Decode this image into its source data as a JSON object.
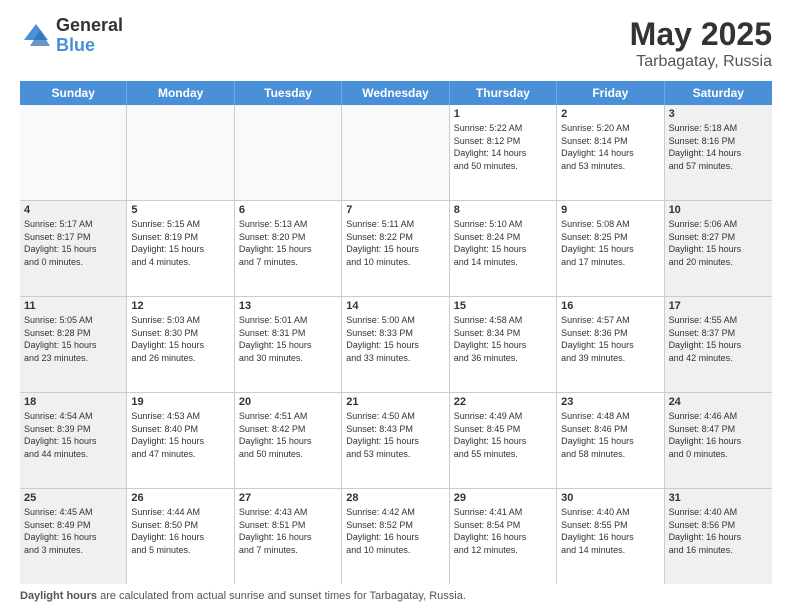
{
  "header": {
    "logo_general": "General",
    "logo_blue": "Blue",
    "title": "May 2025",
    "location": "Tarbagatay, Russia"
  },
  "days_of_week": [
    "Sunday",
    "Monday",
    "Tuesday",
    "Wednesday",
    "Thursday",
    "Friday",
    "Saturday"
  ],
  "footer": {
    "label": "Daylight hours",
    "text": " are calculated from actual sunrise and sunset times for Tarbagatay, Russia."
  },
  "weeks": [
    [
      {
        "day": "",
        "info": ""
      },
      {
        "day": "",
        "info": ""
      },
      {
        "day": "",
        "info": ""
      },
      {
        "day": "",
        "info": ""
      },
      {
        "day": "1",
        "info": "Sunrise: 5:22 AM\nSunset: 8:12 PM\nDaylight: 14 hours\nand 50 minutes."
      },
      {
        "day": "2",
        "info": "Sunrise: 5:20 AM\nSunset: 8:14 PM\nDaylight: 14 hours\nand 53 minutes."
      },
      {
        "day": "3",
        "info": "Sunrise: 5:18 AM\nSunset: 8:16 PM\nDaylight: 14 hours\nand 57 minutes."
      }
    ],
    [
      {
        "day": "4",
        "info": "Sunrise: 5:17 AM\nSunset: 8:17 PM\nDaylight: 15 hours\nand 0 minutes."
      },
      {
        "day": "5",
        "info": "Sunrise: 5:15 AM\nSunset: 8:19 PM\nDaylight: 15 hours\nand 4 minutes."
      },
      {
        "day": "6",
        "info": "Sunrise: 5:13 AM\nSunset: 8:20 PM\nDaylight: 15 hours\nand 7 minutes."
      },
      {
        "day": "7",
        "info": "Sunrise: 5:11 AM\nSunset: 8:22 PM\nDaylight: 15 hours\nand 10 minutes."
      },
      {
        "day": "8",
        "info": "Sunrise: 5:10 AM\nSunset: 8:24 PM\nDaylight: 15 hours\nand 14 minutes."
      },
      {
        "day": "9",
        "info": "Sunrise: 5:08 AM\nSunset: 8:25 PM\nDaylight: 15 hours\nand 17 minutes."
      },
      {
        "day": "10",
        "info": "Sunrise: 5:06 AM\nSunset: 8:27 PM\nDaylight: 15 hours\nand 20 minutes."
      }
    ],
    [
      {
        "day": "11",
        "info": "Sunrise: 5:05 AM\nSunset: 8:28 PM\nDaylight: 15 hours\nand 23 minutes."
      },
      {
        "day": "12",
        "info": "Sunrise: 5:03 AM\nSunset: 8:30 PM\nDaylight: 15 hours\nand 26 minutes."
      },
      {
        "day": "13",
        "info": "Sunrise: 5:01 AM\nSunset: 8:31 PM\nDaylight: 15 hours\nand 30 minutes."
      },
      {
        "day": "14",
        "info": "Sunrise: 5:00 AM\nSunset: 8:33 PM\nDaylight: 15 hours\nand 33 minutes."
      },
      {
        "day": "15",
        "info": "Sunrise: 4:58 AM\nSunset: 8:34 PM\nDaylight: 15 hours\nand 36 minutes."
      },
      {
        "day": "16",
        "info": "Sunrise: 4:57 AM\nSunset: 8:36 PM\nDaylight: 15 hours\nand 39 minutes."
      },
      {
        "day": "17",
        "info": "Sunrise: 4:55 AM\nSunset: 8:37 PM\nDaylight: 15 hours\nand 42 minutes."
      }
    ],
    [
      {
        "day": "18",
        "info": "Sunrise: 4:54 AM\nSunset: 8:39 PM\nDaylight: 15 hours\nand 44 minutes."
      },
      {
        "day": "19",
        "info": "Sunrise: 4:53 AM\nSunset: 8:40 PM\nDaylight: 15 hours\nand 47 minutes."
      },
      {
        "day": "20",
        "info": "Sunrise: 4:51 AM\nSunset: 8:42 PM\nDaylight: 15 hours\nand 50 minutes."
      },
      {
        "day": "21",
        "info": "Sunrise: 4:50 AM\nSunset: 8:43 PM\nDaylight: 15 hours\nand 53 minutes."
      },
      {
        "day": "22",
        "info": "Sunrise: 4:49 AM\nSunset: 8:45 PM\nDaylight: 15 hours\nand 55 minutes."
      },
      {
        "day": "23",
        "info": "Sunrise: 4:48 AM\nSunset: 8:46 PM\nDaylight: 15 hours\nand 58 minutes."
      },
      {
        "day": "24",
        "info": "Sunrise: 4:46 AM\nSunset: 8:47 PM\nDaylight: 16 hours\nand 0 minutes."
      }
    ],
    [
      {
        "day": "25",
        "info": "Sunrise: 4:45 AM\nSunset: 8:49 PM\nDaylight: 16 hours\nand 3 minutes."
      },
      {
        "day": "26",
        "info": "Sunrise: 4:44 AM\nSunset: 8:50 PM\nDaylight: 16 hours\nand 5 minutes."
      },
      {
        "day": "27",
        "info": "Sunrise: 4:43 AM\nSunset: 8:51 PM\nDaylight: 16 hours\nand 7 minutes."
      },
      {
        "day": "28",
        "info": "Sunrise: 4:42 AM\nSunset: 8:52 PM\nDaylight: 16 hours\nand 10 minutes."
      },
      {
        "day": "29",
        "info": "Sunrise: 4:41 AM\nSunset: 8:54 PM\nDaylight: 16 hours\nand 12 minutes."
      },
      {
        "day": "30",
        "info": "Sunrise: 4:40 AM\nSunset: 8:55 PM\nDaylight: 16 hours\nand 14 minutes."
      },
      {
        "day": "31",
        "info": "Sunrise: 4:40 AM\nSunset: 8:56 PM\nDaylight: 16 hours\nand 16 minutes."
      }
    ]
  ]
}
